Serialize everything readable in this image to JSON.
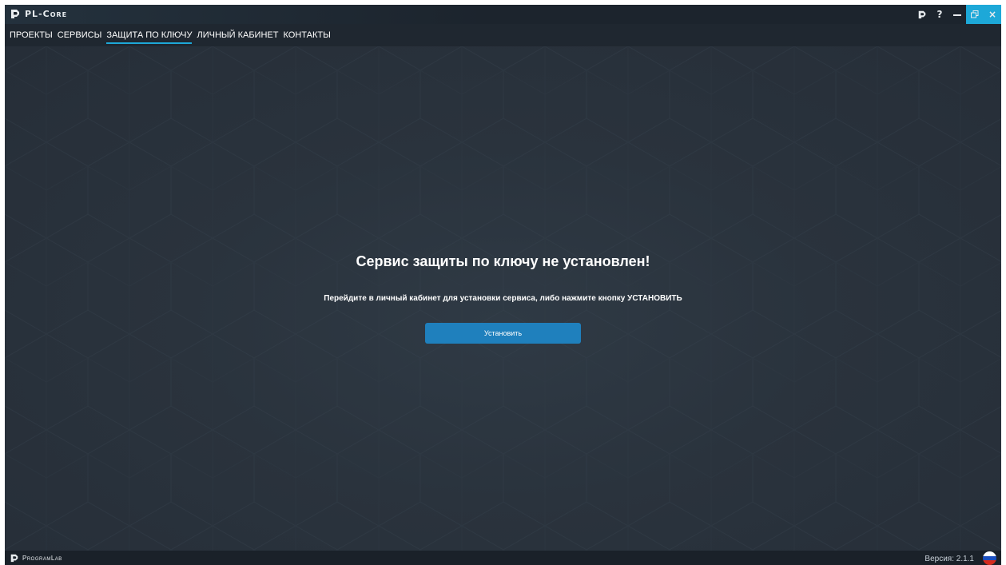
{
  "app": {
    "title": "PL-Core",
    "icon": "pl-core-logo-icon"
  },
  "window_controls": {
    "logo_icon": "pl-core-logo-icon",
    "help_label": "?",
    "minimize_icon": "minimize-icon",
    "restore_icon": "restore-icon",
    "close_label": "×"
  },
  "nav": {
    "items": [
      {
        "label": "ПРОЕКТЫ",
        "active": false
      },
      {
        "label": "СЕРВИСЫ",
        "active": false
      },
      {
        "label": "ЗАЩИТА ПО КЛЮЧУ",
        "active": true
      },
      {
        "label": "ЛИЧНЫЙ КАБИНЕТ",
        "active": false
      },
      {
        "label": "КОНТАКТЫ",
        "active": false
      }
    ]
  },
  "main": {
    "heading": "Сервис защиты по ключу не установлен!",
    "subtext": "Перейдите в личный кабинет для установки сервиса, либо нажмите кнопку УСТАНОВИТЬ",
    "install_button": "Установить"
  },
  "footer": {
    "brand": "ProgramLab",
    "version": "Версия: 2.1.1",
    "language_flag": "russian-flag-icon"
  },
  "colors": {
    "background": "#262e38",
    "accent": "#1da8d8",
    "button": "#1f80bd"
  }
}
